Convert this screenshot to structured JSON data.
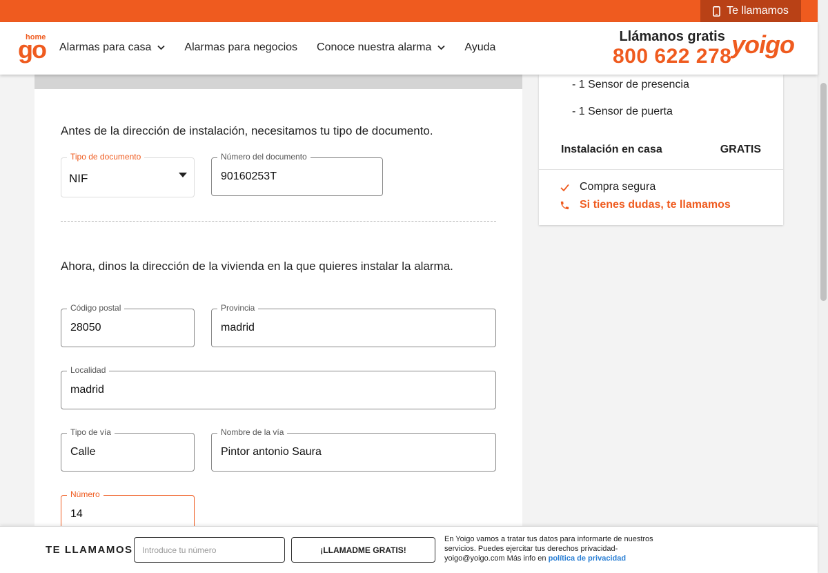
{
  "topbar": {
    "call_label": "Te llamamos"
  },
  "header": {
    "logo_small": "home",
    "logo_big": "go",
    "nav": [
      {
        "label": "Alarmas para casa",
        "has_dropdown": true
      },
      {
        "label": "Alarmas para negocios",
        "has_dropdown": false
      },
      {
        "label": "Conoce nuestra alarma",
        "has_dropdown": true
      },
      {
        "label": "Ayuda",
        "has_dropdown": false
      }
    ],
    "call_title": "Llámanos gratis",
    "call_number": "800 622 278",
    "brand": "yoigo"
  },
  "form": {
    "intro_document": "Antes de la dirección de instalación, necesitamos tu tipo de documento.",
    "doc_type": {
      "label": "Tipo de documento",
      "value": "NIF"
    },
    "doc_number": {
      "label": "Número del documento",
      "value": "90160253T"
    },
    "intro_address": "Ahora, dinos la dirección de la vivienda en la que quieres instalar la alarma.",
    "postal_code": {
      "label": "Código postal",
      "value": "28050"
    },
    "province": {
      "label": "Provincia",
      "value": "madrid"
    },
    "locality": {
      "label": "Localidad",
      "value": "madrid"
    },
    "street_type": {
      "label": "Tipo de vía",
      "value": "Calle"
    },
    "street_name": {
      "label": "Nombre de la vía",
      "value": "Pintor antonio Saura"
    },
    "number": {
      "label": "Número",
      "value": "14"
    }
  },
  "summary": {
    "items": [
      "- 1 Sensor de presencia",
      "- 1 Sensor de puerta"
    ],
    "install_label": "Instalación en casa",
    "install_value": "GRATIS",
    "secure": "Compra segura",
    "doubts_link": "Si tienes dudas, te llamamos"
  },
  "bottombar": {
    "title": "TE LLAMAMOS",
    "phone_placeholder": "Introduce tu número",
    "button": "¡LLAMADME GRATIS!",
    "legal_text": "En Yoigo vamos a tratar tus datos para informarte de nuestros servicios. Puedes ejercitar tus derechos privacidad-yoigo@yoigo.com Más info en",
    "legal_link": "política de privacidad"
  },
  "colors": {
    "accent": "#ef5b1f",
    "accent_dark": "#b94116",
    "link": "#2a7fd4"
  }
}
